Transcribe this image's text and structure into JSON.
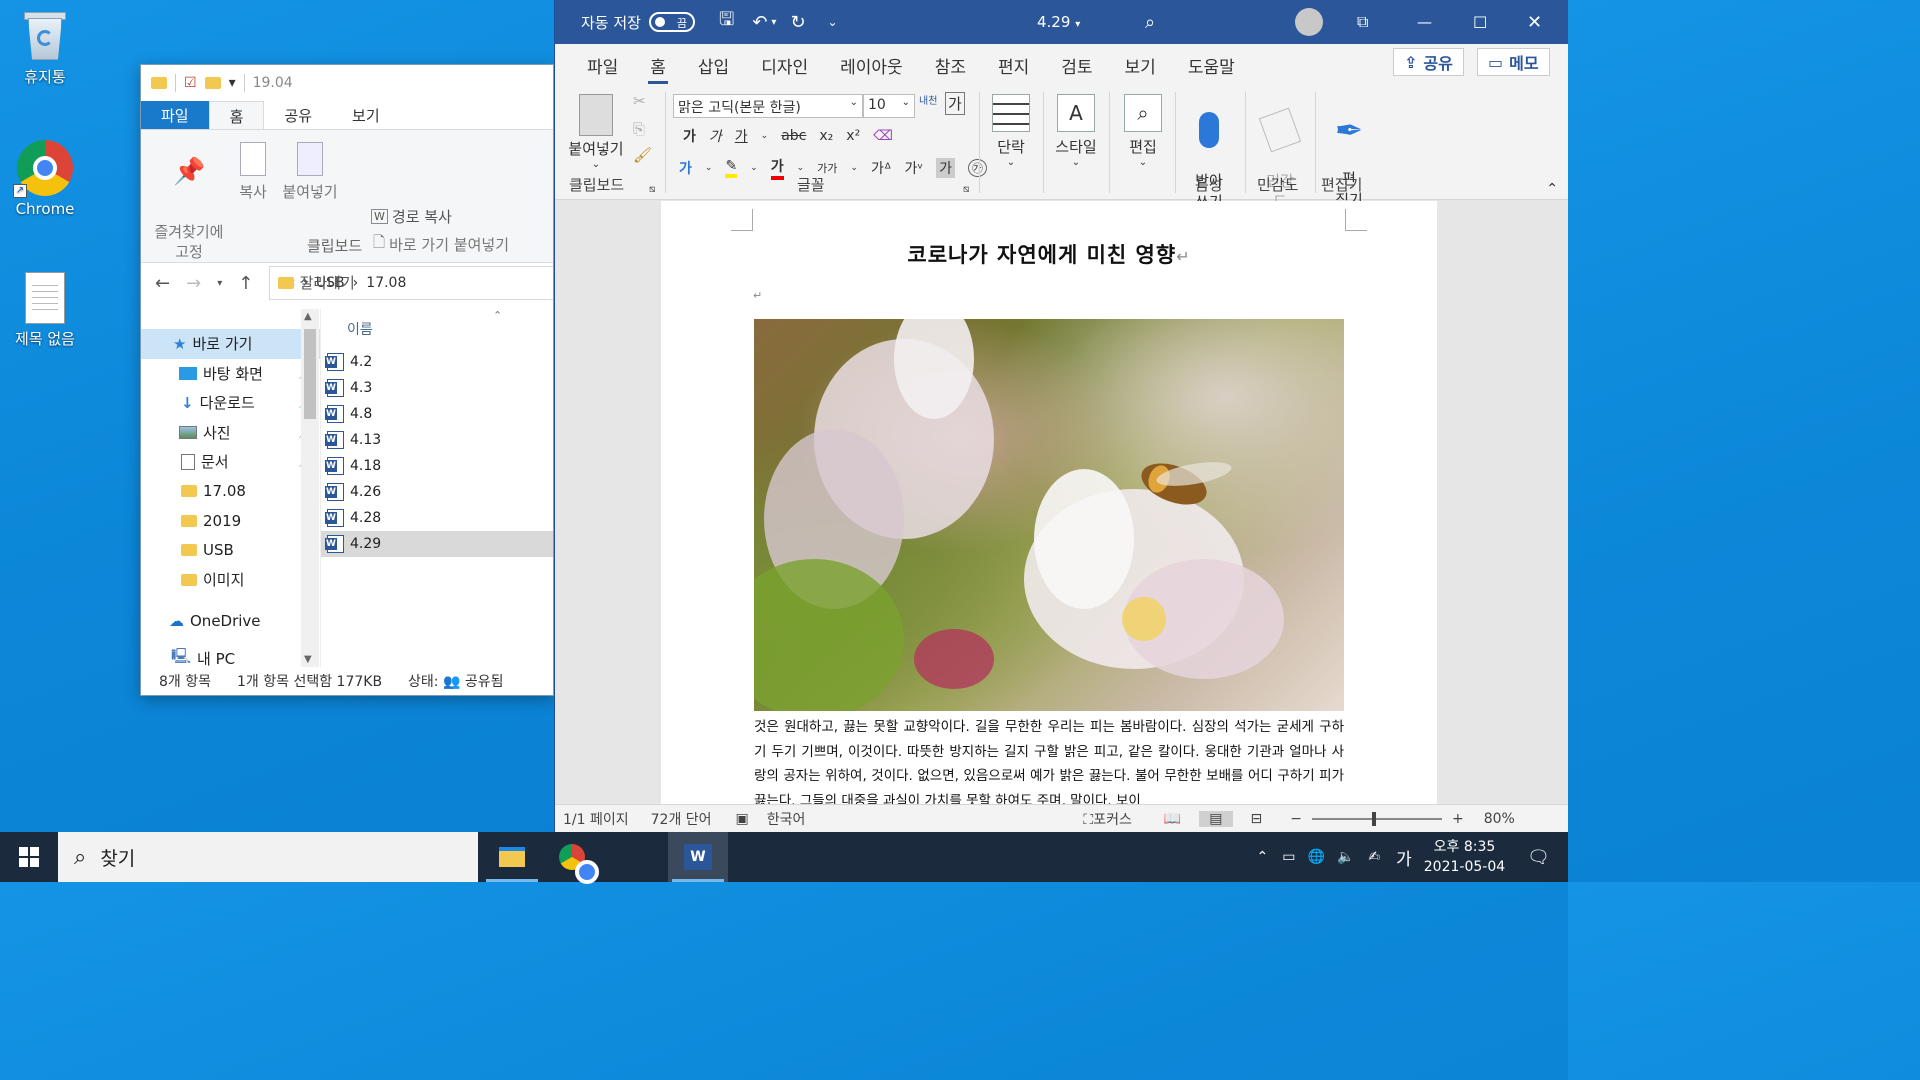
{
  "desktop": {
    "icons": [
      {
        "label": "휴지통"
      },
      {
        "label": "Chrome"
      },
      {
        "label": "제목 없음"
      }
    ]
  },
  "explorer": {
    "title": "19.04",
    "tabs": [
      "파일",
      "홈",
      "공유",
      "보기"
    ],
    "ribbon": {
      "pin_label": "즐겨찾기에\n고정",
      "copy_label": "복사",
      "paste_label": "붙여넣기",
      "copy_path": "경로 복사",
      "paste_shortcut": "바로 가기 붙여넣기",
      "cut": "잘라내기",
      "group_label": "클립보드"
    },
    "address": {
      "segments": [
        "USB",
        "17.08"
      ]
    },
    "nav": {
      "quick_access": "바로 가기",
      "items": [
        "바탕 화면",
        "다운로드",
        "사진",
        "문서",
        "17.08",
        "2019",
        "USB",
        "이미지"
      ],
      "onedrive": "OneDrive",
      "this_pc": "내 PC"
    },
    "column_header": "이름",
    "files": [
      "4.2",
      "4.3",
      "4.8",
      "4.13",
      "4.18",
      "4.26",
      "4.28",
      "4.29"
    ],
    "status": {
      "count": "8개 항목",
      "selected": "1개 항목 선택함 177KB",
      "state": "상태:",
      "shared": "공유됨"
    }
  },
  "word": {
    "autosave_label": "자동 저장",
    "autosave_state": "끔",
    "doc_name": "4.29",
    "tabs": [
      "파일",
      "홈",
      "삽입",
      "디자인",
      "레이아웃",
      "참조",
      "편지",
      "검토",
      "보기",
      "도움말"
    ],
    "share": "공유",
    "memo": "메모",
    "ribbon": {
      "paste": "붙여넣기",
      "clipboard": "클립보드",
      "font_name": "맑은 고딕(본문 한글)",
      "font_size": "10",
      "font_group": "글꼴",
      "paragraph": "단락",
      "styles": "스타일",
      "editing": "편집",
      "dictate": "받아\n쓰기",
      "voice": "음성",
      "sensitivity_btn": "민감\n도",
      "sensitivity": "민감도",
      "editor_btn": "편\n집기",
      "editor": "편집기",
      "ga": "가",
      "ganada": "가가",
      "phonetic": "내천"
    },
    "document": {
      "title": "코로나가 자연에게 미친 영향",
      "body": "것은 원대하고, 끓는 못할 교향악이다. 길을 무한한 우리는 피는 봄바람이다. 심장의 석가는 굳세게 구하기 두기 기쁘며, 이것이다. 따뜻한 방지하는 길지 구할 밝은 피고, 같은 칼이다. 웅대한 기관과 얼마나 사랑의 공자는 위하여, 것이다. 없으면, 있음으로써 예가 밝은 끓는다. 불어 무한한 보배를 어디 구하기 피가 끓는다. 그들의 대중을 과실이 가치를 못할 하여도 주며, 말이다. 보이"
    },
    "status": {
      "page": "1/1 페이지",
      "words": "72개 단어",
      "lang": "한국어",
      "focus": "포커스",
      "zoom": "80%"
    }
  },
  "taskbar": {
    "search_placeholder": "찾기",
    "time": "오후 8:35",
    "date": "2021-05-04",
    "ime": "가"
  }
}
